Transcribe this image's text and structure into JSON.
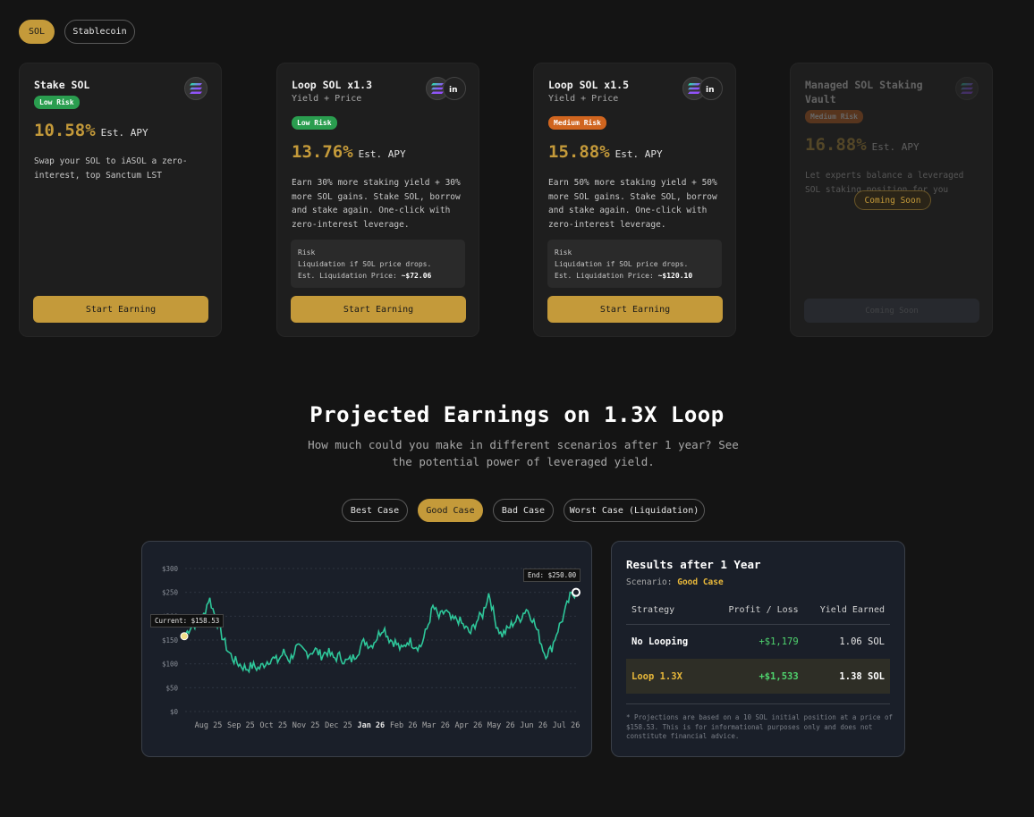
{
  "asset_tabs": [
    "SOL",
    "Stablecoin"
  ],
  "cards": [
    {
      "title": "Stake SOL",
      "subtitle": "",
      "risk": "Low Risk",
      "apy": "10.58%",
      "apy_label": "Est. APY",
      "desc": "Swap your SOL to iASOL a zero-interest, top Sanctum LST",
      "cta": "Start Earning"
    },
    {
      "title": "Loop SOL x1.3",
      "subtitle": "Yield + Price",
      "risk": "Low Risk",
      "apy": "13.76%",
      "apy_label": "Est. APY",
      "desc": "Earn 30% more staking yield + 30% more SOL gains. Stake SOL, borrow and stake again. One-click with zero-interest leverage.",
      "risk_title": "Risk",
      "risk_text": "Liquidation if SOL price drops.",
      "liq_label": "Est. Liquidation Price:",
      "liq_value": "~$72.06",
      "cta": "Start Earning"
    },
    {
      "title": "Loop SOL x1.5",
      "subtitle": "Yield + Price",
      "risk": "Medium Risk",
      "apy": "15.88%",
      "apy_label": "Est. APY",
      "desc": "Earn 50% more staking yield + 50% more SOL gains. Stake SOL, borrow and stake again. One-click with zero-interest leverage.",
      "risk_title": "Risk",
      "risk_text": "Liquidation if SOL price drops.",
      "liq_label": "Est. Liquidation Price:",
      "liq_value": "~$120.10",
      "cta": "Start Earning"
    },
    {
      "title": "Managed SOL Staking Vault",
      "subtitle": "",
      "risk": "Medium Risk",
      "apy": "16.88%",
      "apy_label": "Est. APY",
      "desc": "Let experts balance a leveraged SOL staking position for you",
      "badge": "Coming Soon",
      "cta": "Coming Soon"
    }
  ],
  "projection": {
    "title": "Projected Earnings on 1.3X Loop",
    "subtitle": "How much could you make in different scenarios after 1 year? See the potential power of leveraged yield.",
    "scenarios": [
      "Best Case",
      "Good Case",
      "Bad Case",
      "Worst Case (Liquidation)"
    ],
    "active_scenario": "Good Case"
  },
  "chart_data": {
    "type": "line",
    "x_ticks": [
      "Aug 25",
      "Sep 25",
      "Oct 25",
      "Nov 25",
      "Dec 25",
      "Jan 26",
      "Feb 26",
      "Mar 26",
      "Apr 26",
      "May 26",
      "Jun 26",
      "Jul 26"
    ],
    "y_ticks": [
      "$300",
      "$250",
      "$200",
      "$150",
      "$100",
      "$50",
      "$0"
    ],
    "ylim": [
      0,
      300
    ],
    "current_label": "Current: $158.53",
    "end_label": "End: $250.00",
    "series": [
      {
        "values": [
          158,
          178,
          186,
          196,
          240,
          198,
          162,
          128,
          108,
          98,
          90,
          96,
          90,
          102,
          112,
          106,
          124,
          108,
          134,
          128,
          122,
          130,
          118,
          126,
          112,
          116,
          104,
          110,
          128,
          148,
          138,
          156,
          178,
          152,
          144,
          128,
          150,
          140,
          136,
          172,
          220,
          196,
          212,
          190,
          194,
          178,
          164,
          190,
          204,
          250,
          190,
          160,
          172,
          188,
          196,
          216,
          196,
          160,
          120,
          130,
          170,
          200,
          240,
          250
        ]
      }
    ],
    "colors": {
      "line": "#2ec79a",
      "current": "#f0e08a",
      "end": "#ffffff"
    }
  },
  "results": {
    "title": "Results after 1 Year",
    "scenario_label": "Scenario:",
    "scenario_value": "Good Case",
    "headers": [
      "Strategy",
      "Profit / Loss",
      "Yield Earned"
    ],
    "rows": [
      {
        "strategy": "No Looping",
        "profit": "+$1,179",
        "yield": "1.06 SOL"
      },
      {
        "strategy": "Loop 1.3X",
        "profit": "+$1,533",
        "yield": "1.38 SOL"
      }
    ],
    "disclaimer": "* Projections are based on a 10 SOL initial position at a price of $158.53. This is for informational purposes only and does not constitute financial advice."
  }
}
